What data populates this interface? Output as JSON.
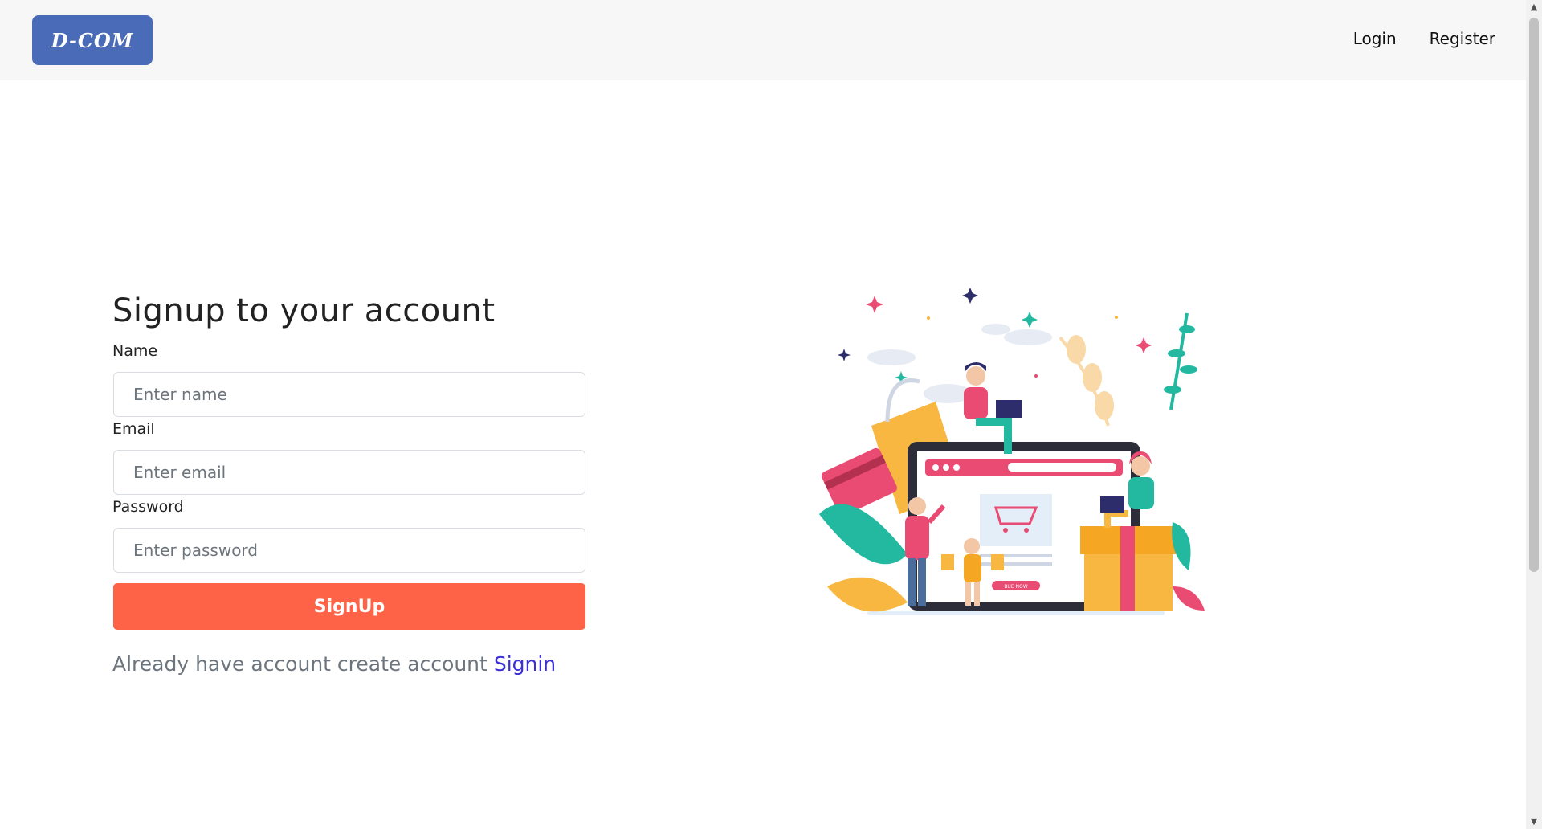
{
  "navbar": {
    "logo_text": "D-COM",
    "links": [
      "Login",
      "Register"
    ]
  },
  "form": {
    "title": "Signup to your account",
    "name_label": "Name",
    "name_placeholder": "Enter name",
    "email_label": "Email",
    "email_placeholder": "Enter email",
    "password_label": "Password",
    "password_placeholder": "Enter password",
    "submit_label": "SignUp",
    "switch_text": "Already have account create account",
    "switch_link": "Signin"
  },
  "illustration": {
    "banner_button": "BUE NOW"
  },
  "colors": {
    "accent": "#ff6347",
    "logo_bg": "#4a6bb8",
    "link": "#3b2fd6"
  }
}
